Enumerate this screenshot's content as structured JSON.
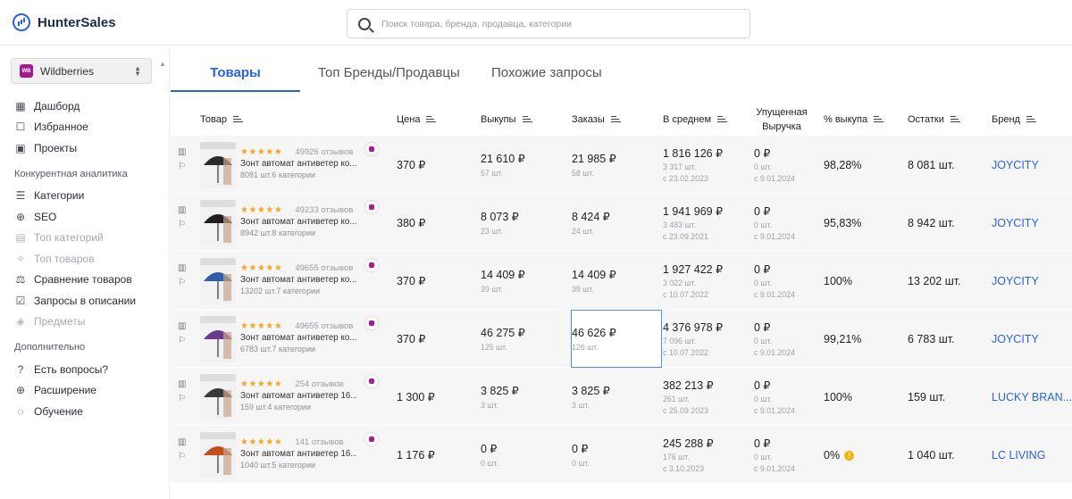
{
  "app": {
    "name": "HunterSales"
  },
  "search": {
    "placeholder": "Поиск товара, бренда, продавца, категории"
  },
  "marketplace": {
    "selected": "Wildberries",
    "badge": "WB"
  },
  "sidebar": {
    "main": [
      {
        "label": "Дашборд",
        "icon": "dashboard-icon",
        "disabled": false
      },
      {
        "label": "Избранное",
        "icon": "favorites-icon",
        "disabled": false
      },
      {
        "label": "Проекты",
        "icon": "projects-icon",
        "disabled": false
      }
    ],
    "section1": "Конкурентная аналитика",
    "analytics": [
      {
        "label": "Категории",
        "icon": "list-icon",
        "disabled": false
      },
      {
        "label": "SEO",
        "icon": "target-icon",
        "disabled": false
      },
      {
        "label": "Топ категорий",
        "icon": "top-categories-icon",
        "disabled": true
      },
      {
        "label": "Топ товаров",
        "icon": "top-products-icon",
        "disabled": true
      },
      {
        "label": "Сравнение товаров",
        "icon": "compare-icon",
        "disabled": false
      },
      {
        "label": "Запросы в описании",
        "icon": "check-icon",
        "disabled": false
      },
      {
        "label": "Предметы",
        "icon": "items-icon",
        "disabled": true
      }
    ],
    "section2": "Дополнительно",
    "extra": [
      {
        "label": "Есть вопросы?",
        "icon": "question-icon",
        "disabled": false
      },
      {
        "label": "Расширение",
        "icon": "globe-icon",
        "disabled": false
      },
      {
        "label": "Обучение",
        "icon": "bulb-icon",
        "disabled": false
      }
    ]
  },
  "tabs": [
    "Товары",
    "Топ Бренды/Продавцы",
    "Похожие запросы"
  ],
  "columns": {
    "product": "Товар",
    "price": "Цена",
    "buyouts": "Выкупы",
    "orders": "Заказы",
    "average": "В среднем",
    "lost_1": "Упущенная",
    "lost_2": "Выручка",
    "buyout_pct": "% выкупа",
    "stock": "Остатки",
    "brand": "Бренд"
  },
  "rows": [
    {
      "stars": "★★★★★",
      "reviews": "49926 отзывов",
      "name": "Зонт автомат антиветер ко...",
      "meta": "8081 шт.6 категории",
      "price": "370 ₽",
      "buyouts": "21 610 ₽",
      "buyouts_sub": "57 шт.",
      "orders": "21 985 ₽",
      "orders_sub": "58 шт.",
      "avg": "1 816 126 ₽",
      "avg_sub1": "3 317 шт.",
      "avg_sub2": "с 23.02.2023",
      "lost": "0 ₽",
      "lost_sub1": "0 шт.",
      "lost_sub2": "с 9.01.2024",
      "pct": "98,28%",
      "stock": "8 081 шт.",
      "brand": "JOYCITY",
      "cover_color": "#2b2b2b"
    },
    {
      "stars": "★★★★★",
      "reviews": "49233 отзывов",
      "name": "Зонт автомат антиветер ко...",
      "meta": "8942 шт.8 категории",
      "price": "380 ₽",
      "buyouts": "8 073 ₽",
      "buyouts_sub": "23 шт.",
      "orders": "8 424 ₽",
      "orders_sub": "24 шт.",
      "avg": "1 941 969 ₽",
      "avg_sub1": "3 483 шт.",
      "avg_sub2": "с 23.09.2021",
      "lost": "0 ₽",
      "lost_sub1": "0 шт.",
      "lost_sub2": "с 9.01.2024",
      "pct": "95,83%",
      "stock": "8 942 шт.",
      "brand": "JOYCITY",
      "cover_color": "#1f1f1f"
    },
    {
      "stars": "★★★★★",
      "reviews": "49655 отзывов",
      "name": "Зонт автомат антиветер ко...",
      "meta": "13202 шт.7 категории",
      "price": "370 ₽",
      "buyouts": "14 409 ₽",
      "buyouts_sub": "39 шт.",
      "orders": "14 409 ₽",
      "orders_sub": "39 шт.",
      "avg": "1 927 422 ₽",
      "avg_sub1": "3 022 шт.",
      "avg_sub2": "с 10.07.2022",
      "lost": "0 ₽",
      "lost_sub1": "0 шт.",
      "lost_sub2": "с 9.01.2024",
      "pct": "100%",
      "stock": "13 202 шт.",
      "brand": "JOYCITY",
      "cover_color": "#2e5fa6"
    },
    {
      "stars": "★★★★★",
      "reviews": "49655 отзывов",
      "name": "Зонт автомат антиветер ко...",
      "meta": "6783 шт.7 категории",
      "price": "370 ₽",
      "buyouts": "46 275 ₽",
      "buyouts_sub": "125 шт.",
      "orders": "46 626 ₽",
      "orders_sub": "126 шт.",
      "avg": "4 376 978 ₽",
      "avg_sub1": "7 096 шт.",
      "avg_sub2": "с 10.07.2022",
      "lost": "0 ₽",
      "lost_sub1": "0 шт.",
      "lost_sub2": "с 9.01.2024",
      "pct": "99,21%",
      "stock": "6 783 шт.",
      "brand": "JOYCITY",
      "cover_color": "#6a3a8c"
    },
    {
      "stars": "★★★★★",
      "reviews": "254 отзывов",
      "name": "Зонт автомат антиветер 16...",
      "meta": "159 шт.4 категории",
      "price": "1 300 ₽",
      "buyouts": "3 825 ₽",
      "buyouts_sub": "3 шт.",
      "orders": "3 825 ₽",
      "orders_sub": "3 шт.",
      "avg": "382 213 ₽",
      "avg_sub1": "261 шт.",
      "avg_sub2": "с 25.09.2023",
      "lost": "0 ₽",
      "lost_sub1": "0 шт.",
      "lost_sub2": "с 9.01.2024",
      "pct": "100%",
      "stock": "159 шт.",
      "brand": "LUCKY BRAN...",
      "cover_color": "#3a3a3a"
    },
    {
      "stars": "★★★★★",
      "reviews": "141 отзывов",
      "name": "Зонт автомат антиветер 16...",
      "meta": "1040 шт.5 категории",
      "price": "1 176 ₽",
      "buyouts": "0 ₽",
      "buyouts_sub": "0 шт.",
      "orders": "0 ₽",
      "orders_sub": "0 шт.",
      "avg": "245 288 ₽",
      "avg_sub1": "176 шт.",
      "avg_sub2": "с 3.10.2023",
      "lost": "0 ₽",
      "lost_sub1": "0 шт.",
      "lost_sub2": "с 9.01.2024",
      "pct": "0%",
      "stock": "1 040 шт.",
      "brand": "LC LIVING",
      "cover_color": "#c0501e"
    }
  ],
  "colors": {
    "accent": "#2b62d9",
    "wb": "#a21a8c",
    "stars": "#f5a623",
    "warning": "#f5b40a"
  }
}
